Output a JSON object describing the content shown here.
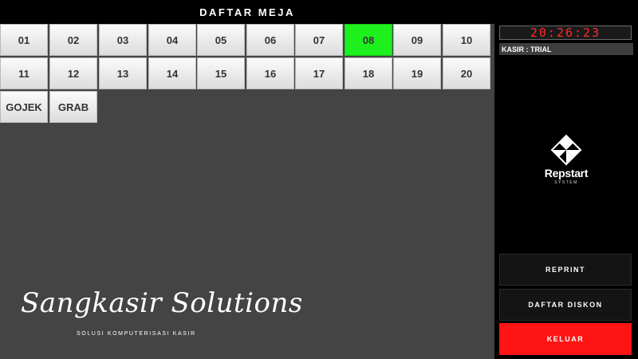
{
  "header": {
    "title": "DAFTAR MEJA"
  },
  "tables": {
    "items": [
      "01",
      "02",
      "03",
      "04",
      "05",
      "06",
      "07",
      "08",
      "09",
      "10",
      "11",
      "12",
      "13",
      "14",
      "15",
      "16",
      "17",
      "18",
      "19",
      "20"
    ],
    "selected": "08",
    "online": [
      "GOJEK",
      "GRAB"
    ]
  },
  "sidebar": {
    "clock": "20:26:23",
    "cashier": "KASIR : TRIAL",
    "logo": {
      "name": "Repstart",
      "sub": "SYSTEM"
    },
    "buttons": {
      "reprint": "REPRINT",
      "discount_list": "DAFTAR DISKON",
      "exit": "KELUAR"
    }
  },
  "branding": {
    "name": "Sangkasir Solutions",
    "tagline": "SOLUSI KOMPUTERISASI KASIR"
  },
  "colors": {
    "selected": "#1ef01e",
    "exit": "#ff1414",
    "clock": "#ff2b2b",
    "panel": "#444444"
  }
}
